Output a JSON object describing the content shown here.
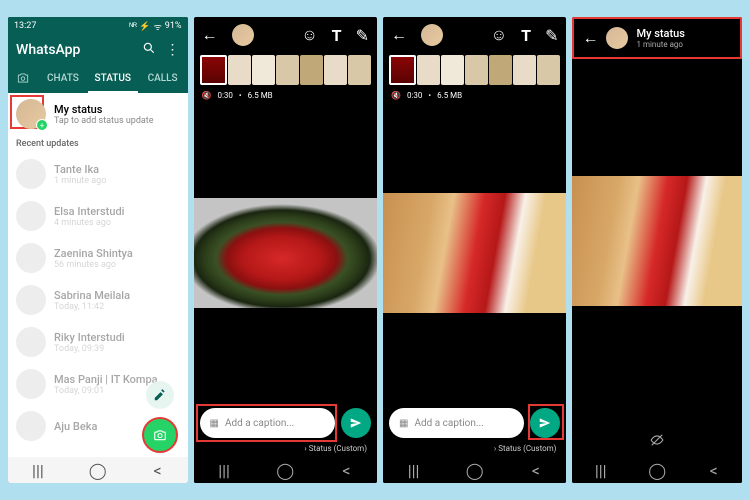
{
  "screen1": {
    "statusbar": {
      "time": "13:27",
      "network": "⚡⚡",
      "signal": "ᴺᴿ ⚡",
      "wifi": "ᯤ",
      "battery": "91%"
    },
    "app_title": "WhatsApp",
    "tabs": {
      "camera": "📷",
      "chats": "CHATS",
      "status": "STATUS",
      "calls": "CALLS"
    },
    "my_status": {
      "title": "My status",
      "subtitle": "Tap to add status update"
    },
    "recent_header": "Recent updates",
    "contacts": [
      {
        "name": "Tante Ika",
        "time": "1 minute ago"
      },
      {
        "name": "Elsa Interstudi",
        "time": "4 minutes ago"
      },
      {
        "name": "Zaenina Shintya",
        "time": "56 minutes ago"
      },
      {
        "name": "Sabrina Meilala",
        "time": "Today, 11:42"
      },
      {
        "name": "Riky Interstudi",
        "time": "Today, 09:39"
      },
      {
        "name": "Mas Panji | IT Kompa",
        "time": "Today, 09:01"
      },
      {
        "name": "Aju Beka",
        "time": ""
      }
    ]
  },
  "editor": {
    "meta_time": "0:30",
    "meta_size": "6.5 MB",
    "caption_placeholder": "Add a caption...",
    "status_label": "Status (Custom)"
  },
  "viewer": {
    "title": "My status",
    "subtitle": "1 minute ago"
  }
}
